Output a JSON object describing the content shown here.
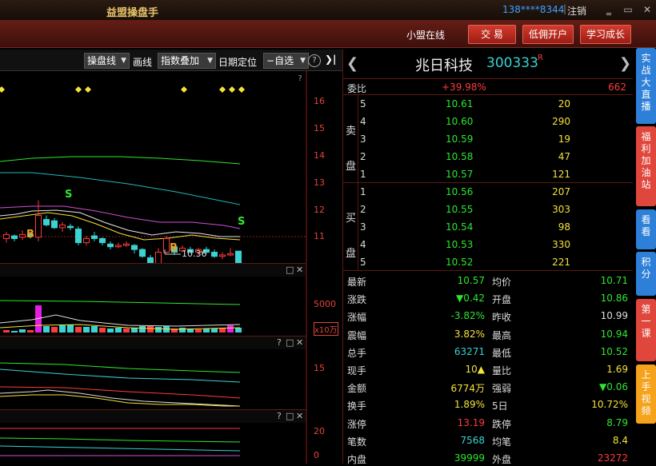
{
  "app_title": "益盟操盘手",
  "account": "138****8344",
  "logout": "注销",
  "window_controls": {
    "minimize": "▭",
    "restore": "▭",
    "close": "✕"
  },
  "toolbar": {
    "label": "小盟在线",
    "btn_trade": "交 易",
    "btn_open": "低佣开户",
    "btn_learn": "学习成长"
  },
  "chart_toolbar": {
    "dd1": "操盘线",
    "line": "画线",
    "dd2": "指数叠加",
    "date_locate": "日期定位",
    "dd3": "自选",
    "help": "?",
    "expand": "❯|"
  },
  "price_axis": [
    "16",
    "15",
    "14",
    "13",
    "12",
    "11"
  ],
  "markers": {
    "b": "B",
    "s": "S",
    "low": "10.36"
  },
  "vol_axis": [
    "5000",
    "x10万"
  ],
  "ind_axis": [
    "15",
    "20",
    "0"
  ],
  "panel_icons": {
    "q": "?",
    "box": "□",
    "x": "✕"
  },
  "stock": {
    "name": "兆日科技",
    "code": "300333",
    "flag": "R",
    "nav_prev": "❮",
    "nav_next": "❯"
  },
  "weibi": {
    "label": "委比",
    "pct": "+39.98%",
    "val": "662"
  },
  "sell_label": "卖盘",
  "buy_label": "买盘",
  "asks": [
    {
      "lv": "5",
      "price": "10.61",
      "vol": "20"
    },
    {
      "lv": "4",
      "price": "10.60",
      "vol": "290"
    },
    {
      "lv": "3",
      "price": "10.59",
      "vol": "19"
    },
    {
      "lv": "2",
      "price": "10.58",
      "vol": "47"
    },
    {
      "lv": "1",
      "price": "10.57",
      "vol": "121"
    }
  ],
  "bids": [
    {
      "lv": "1",
      "price": "10.56",
      "vol": "207"
    },
    {
      "lv": "2",
      "price": "10.55",
      "vol": "303"
    },
    {
      "lv": "3",
      "price": "10.54",
      "vol": "98"
    },
    {
      "lv": "4",
      "price": "10.53",
      "vol": "330"
    },
    {
      "lv": "5",
      "price": "10.52",
      "vol": "221"
    }
  ],
  "stats": [
    {
      "l1": "最新",
      "v1": "10.57",
      "c1": "grn",
      "l2": "均价",
      "v2": "10.71",
      "c2": "grn"
    },
    {
      "l1": "涨跌",
      "v1": "▼0.42",
      "c1": "grn",
      "l2": "开盘",
      "v2": "10.86",
      "c2": "grn"
    },
    {
      "l1": "涨幅",
      "v1": "-3.82%",
      "c1": "grn",
      "l2": "昨收",
      "v2": "10.99",
      "c2": "wht"
    },
    {
      "l1": "震幅",
      "v1": "3.82%",
      "c1": "yel",
      "l2": "最高",
      "v2": "10.94",
      "c2": "grn"
    },
    {
      "l1": "总手",
      "v1": "63271",
      "c1": "cyan",
      "l2": "最低",
      "v2": "10.52",
      "c2": "grn"
    },
    {
      "l1": "现手",
      "v1": "10▲",
      "c1": "yel",
      "l2": "量比",
      "v2": "1.69",
      "c2": "yel"
    },
    {
      "l1": "金额",
      "v1": "6774万",
      "c1": "yel",
      "l2": "强弱",
      "v2": "▼0.06",
      "c2": "grn"
    },
    {
      "l1": "换手",
      "v1": "1.89%",
      "c1": "yel",
      "l2": "5日",
      "v2": "10.72%",
      "c2": "yel"
    },
    {
      "l1": "涨停",
      "v1": "13.19",
      "c1": "red",
      "l2": "跌停",
      "v2": "8.79",
      "c2": "grn"
    },
    {
      "l1": "笔数",
      "v1": "7568",
      "c1": "cyan",
      "l2": "均笔",
      "v2": "8.4",
      "c2": "yel"
    },
    {
      "l1": "内盘",
      "v1": "39999",
      "c1": "grn",
      "l2": "外盘",
      "v2": "23272",
      "c2": "red"
    }
  ],
  "sidebar": [
    {
      "label": "实战大直播",
      "color": "#2d7fd8"
    },
    {
      "label": "福利加油站",
      "color": "#e0473c"
    },
    {
      "label": "看看",
      "color": "#2d7fd8"
    },
    {
      "label": "积分",
      "color": "#2d7fd8"
    },
    {
      "label": "第一课",
      "color": "#e0473c"
    },
    {
      "label": "上手视频",
      "color": "#f5a21c"
    }
  ],
  "chart_data": {
    "type": "candlestick",
    "ylim": [
      10,
      16.5
    ],
    "candles": [
      {
        "o": 11.45,
        "c": 11.6,
        "h": 11.7,
        "l": 11.3
      },
      {
        "o": 11.55,
        "c": 11.45,
        "h": 11.6,
        "l": 11.35
      },
      {
        "o": 11.5,
        "c": 11.6,
        "h": 11.75,
        "l": 11.4
      },
      {
        "o": 11.6,
        "c": 11.55,
        "h": 11.7,
        "l": 11.45
      },
      {
        "o": 11.5,
        "c": 12.3,
        "h": 12.85,
        "l": 11.35
      },
      {
        "o": 12.15,
        "c": 11.95,
        "h": 12.3,
        "l": 11.9
      },
      {
        "o": 12.1,
        "c": 11.85,
        "h": 12.2,
        "l": 11.8
      },
      {
        "o": 11.85,
        "c": 11.95,
        "h": 12.05,
        "l": 11.7
      },
      {
        "o": 11.9,
        "c": 11.85,
        "h": 12.0,
        "l": 11.75
      },
      {
        "o": 11.8,
        "c": 11.3,
        "h": 11.9,
        "l": 11.2
      },
      {
        "o": 11.3,
        "c": 11.45,
        "h": 11.55,
        "l": 11.2
      },
      {
        "o": 11.55,
        "c": 11.45,
        "h": 11.7,
        "l": 11.35
      },
      {
        "o": 11.45,
        "c": 11.3,
        "h": 11.5,
        "l": 11.2
      },
      {
        "o": 11.25,
        "c": 11.15,
        "h": 11.35,
        "l": 11.05
      },
      {
        "o": 11.15,
        "c": 11.2,
        "h": 11.3,
        "l": 11.1
      },
      {
        "o": 11.2,
        "c": 11.25,
        "h": 11.35,
        "l": 11.15
      },
      {
        "o": 11.2,
        "c": 11.05,
        "h": 11.25,
        "l": 10.9
      },
      {
        "o": 11.05,
        "c": 10.8,
        "h": 11.1,
        "l": 10.75
      },
      {
        "o": 10.75,
        "c": 10.45,
        "h": 10.85,
        "l": 10.36
      },
      {
        "o": 10.5,
        "c": 10.95,
        "h": 11.1,
        "l": 10.45
      },
      {
        "o": 10.95,
        "c": 11.45,
        "h": 11.55,
        "l": 10.9
      },
      {
        "o": 11.15,
        "c": 10.95,
        "h": 11.2,
        "l": 10.85
      },
      {
        "o": 11.0,
        "c": 11.1,
        "h": 11.2,
        "l": 10.95
      },
      {
        "o": 11.05,
        "c": 10.95,
        "h": 11.15,
        "l": 10.9
      },
      {
        "o": 10.95,
        "c": 11.05,
        "h": 11.1,
        "l": 10.85
      },
      {
        "o": 11.05,
        "c": 10.95,
        "h": 11.15,
        "l": 10.9
      },
      {
        "o": 10.95,
        "c": 10.8,
        "h": 11.05,
        "l": 10.75
      },
      {
        "o": 10.8,
        "c": 10.85,
        "h": 10.95,
        "l": 10.7
      },
      {
        "o": 10.85,
        "c": 10.9,
        "h": 11.1,
        "l": 10.8
      },
      {
        "o": 10.99,
        "c": 10.57,
        "h": 10.94,
        "l": 10.52
      }
    ]
  }
}
